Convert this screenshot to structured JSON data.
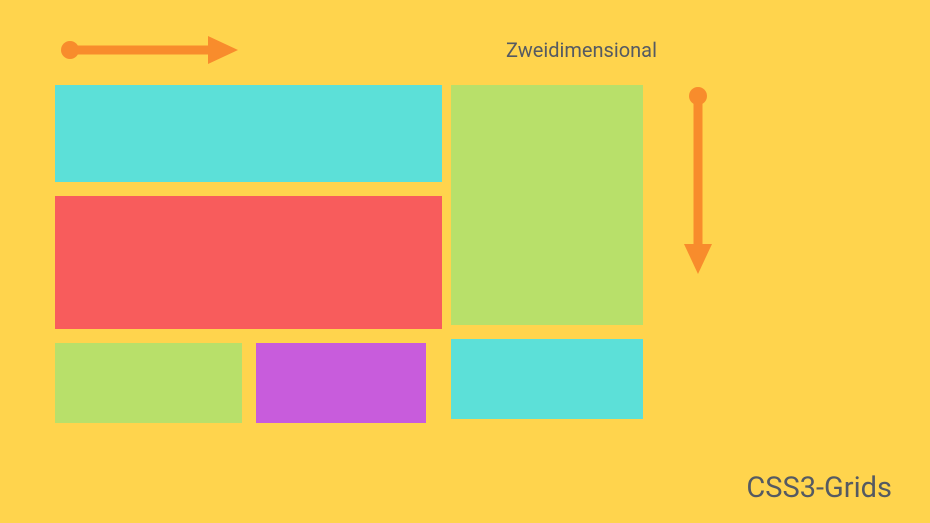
{
  "subtitle": "Zweidimensional",
  "footer": "CSS3-Grids",
  "colors": {
    "background": "#ffd44d",
    "arrow": "#f88c2c",
    "cyan": "#5ce0d8",
    "red": "#f85c5c",
    "green": "#b8e06a",
    "purple": "#c85cdc",
    "text": "#555a62"
  },
  "arrows": {
    "horizontal": {
      "direction": "right"
    },
    "vertical": {
      "direction": "down"
    }
  },
  "grid_cells": [
    {
      "id": "a",
      "color": "cyan",
      "span": "row1-wide"
    },
    {
      "id": "b",
      "color": "red",
      "span": "row2-wide"
    },
    {
      "id": "tall",
      "color": "green",
      "span": "col3-tall"
    },
    {
      "id": "c",
      "color": "green",
      "span": "row3-col1"
    },
    {
      "id": "d",
      "color": "purple",
      "span": "row3-col2"
    },
    {
      "id": "e",
      "color": "cyan",
      "span": "row3-col3"
    }
  ]
}
